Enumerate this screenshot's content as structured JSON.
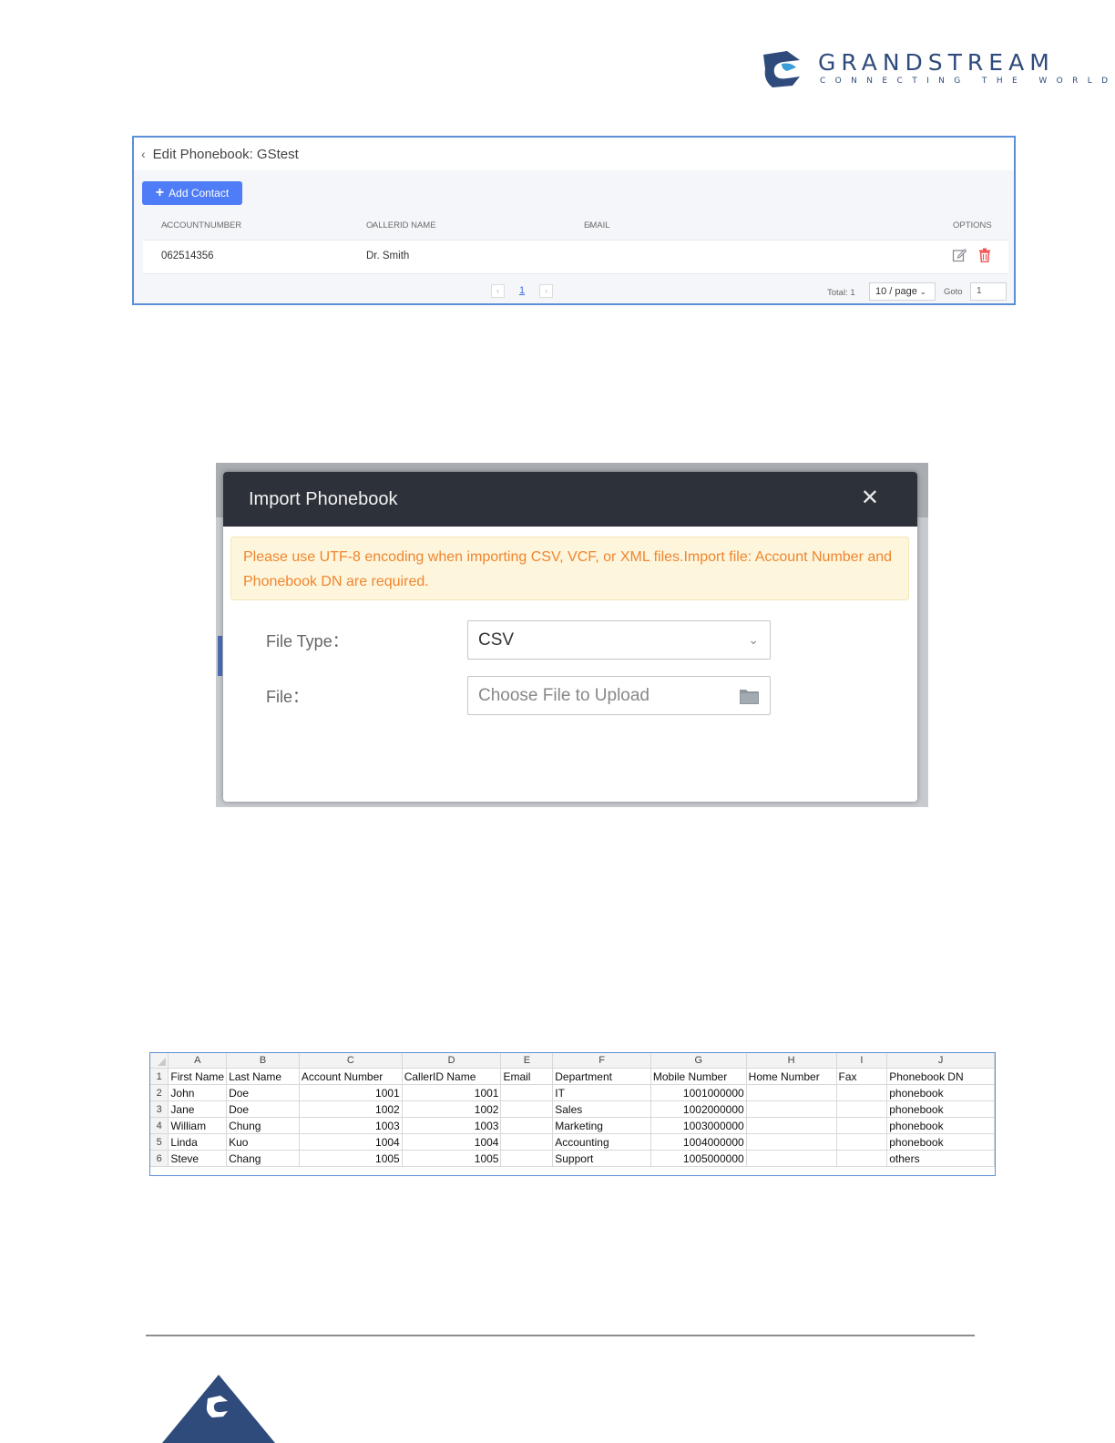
{
  "logo": {
    "brand": "GRANDSTREAM",
    "tagline": "CONNECTING THE WORLD",
    "colors": {
      "primary": "#2f4b7c",
      "accent": "#3a9fd8"
    }
  },
  "phonebook": {
    "title": "Edit Phonebook: GStest",
    "back_icon": "chevron-left-icon",
    "add_button": "Add Contact",
    "columns": {
      "account": "ACCOUNTNUMBER",
      "callerid": "CALLERID NAME",
      "email": "EMAIL",
      "options": "OPTIONS"
    },
    "rows": [
      {
        "account": "062514356",
        "callerid": "Dr. Smith",
        "email": ""
      }
    ],
    "pagination": {
      "current_page": "1",
      "total": "Total: 1",
      "page_size": "10 / page",
      "goto_label": "Goto",
      "goto_value": "1"
    },
    "accent": "#4f7cf7"
  },
  "import_dialog": {
    "title": "Import Phonebook",
    "close_icon": "close-icon",
    "warning": "Please use UTF-8 encoding when importing CSV, VCF, or XML files.Import file: Account Number and Phonebook DN are required.",
    "file_type_label": "File Type：",
    "file_type_value": "CSV",
    "file_label": "File：",
    "file_placeholder": "Choose File to Upload",
    "folder_icon": "folder-icon",
    "warning_color": "#f0862f"
  },
  "spreadsheet": {
    "column_letters": [
      "A",
      "B",
      "C",
      "D",
      "E",
      "F",
      "G",
      "H",
      "I",
      "J"
    ],
    "headers": [
      "First Name",
      "Last Name",
      "Account Number",
      "CallerID Name",
      "Email",
      "Department",
      "Mobile Number",
      "Home Number",
      "Fax",
      "Phonebook DN"
    ],
    "rows": [
      {
        "n": "2",
        "cells": [
          "John",
          "Doe",
          "1001",
          "1001",
          "",
          "IT",
          "1001000000",
          "",
          "",
          "phonebook"
        ]
      },
      {
        "n": "3",
        "cells": [
          "Jane",
          "Doe",
          "1002",
          "1002",
          "",
          "Sales",
          "1002000000",
          "",
          "",
          "phonebook"
        ]
      },
      {
        "n": "4",
        "cells": [
          "William",
          "Chung",
          "1003",
          "1003",
          "",
          "Marketing",
          "1003000000",
          "",
          "",
          "phonebook"
        ]
      },
      {
        "n": "5",
        "cells": [
          "Linda",
          "Kuo",
          "1004",
          "1004",
          "",
          "Accounting",
          "1004000000",
          "",
          "",
          "phonebook"
        ]
      },
      {
        "n": "6",
        "cells": [
          "Steve",
          "Chang",
          "1005",
          "1005",
          "",
          "Support",
          "1005000000",
          "",
          "",
          "others"
        ]
      }
    ],
    "header_row_number": "1"
  }
}
